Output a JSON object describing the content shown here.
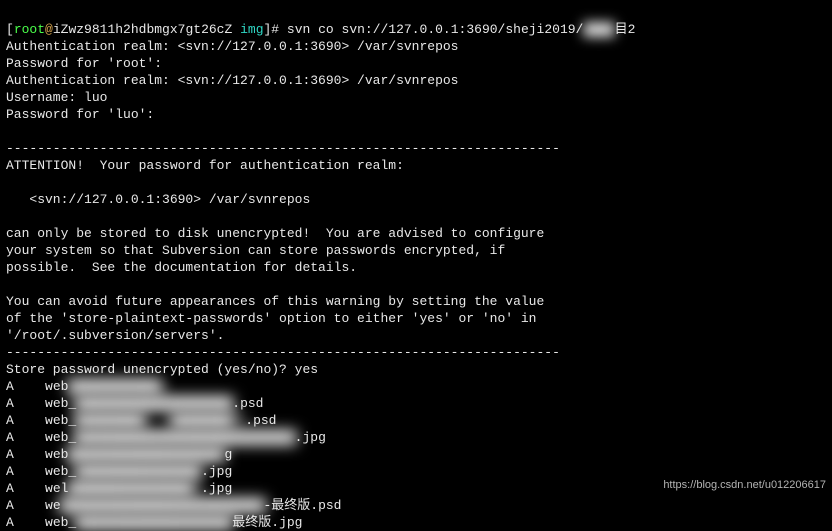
{
  "prompt": {
    "open_br": "[",
    "user": "root",
    "at": "@",
    "host": "iZwz9811h2hdbmgx7gt26cZ",
    "dir": "img",
    "close_br": "]# ",
    "command": "svn co svn://127.0.0.1:3690/sheji2019/",
    "tail_blur": "████",
    "tail_plain": "目2"
  },
  "lines": {
    "l1": "Authentication realm: <svn://127.0.0.1:3690> /var/svnrepos",
    "l2": "Password for 'root':",
    "l3": "Authentication realm: <svn://127.0.0.1:3690> /var/svnrepos",
    "l4": "Username: luo",
    "l5": "Password for 'luo':",
    "l6": "",
    "sep": "-----------------------------------------------------------------------",
    "l7": "ATTENTION!  Your password for authentication realm:",
    "l8": "",
    "l9": "   <svn://127.0.0.1:3690> /var/svnrepos",
    "l10": "",
    "l11": "can only be stored to disk unencrypted!  You are advised to configure",
    "l12": "your system so that Subversion can store passwords encrypted, if",
    "l13": "possible.  See the documentation for details.",
    "l14": "",
    "l15": "You can avoid future appearances of this warning by setting the value",
    "l16": "of the 'store-plaintext-passwords' option to either 'yes' or 'no' in",
    "l17": "'/root/.subversion/servers'.",
    "l18": "Store password unencrypted (yes/no)? yes"
  },
  "files": {
    "prefix": "A    ",
    "r1_a": "web",
    "r1_b": "████████████",
    "r2_a": "web_",
    "r2_b": "████████████████████",
    "r2_c": ".psd",
    "r3_a": "web_",
    "r3_b": "█████████   ████████本",
    "r3_c": ".psd",
    "r4_a": "web_",
    "r4_b": "████████████████████████████",
    "r4_c": ".jpg",
    "r5_a": "web",
    "r5_b": "████████████████████",
    "r5_c": "g",
    "r6_a": "web_",
    "r6_b": "████████████████",
    "r6_c": ".jpg",
    "r7_a": "wel",
    "r7_b": "████████████████3",
    "r7_c": ".jpg",
    "r8_a": "we",
    "r8_b": "██████████████████████████",
    "r8_c": "-最终版.psd",
    "r9_a": "web_",
    "r9_b": "████████████████████",
    "r9_c": "最终版.jpg"
  },
  "watermark": "https://blog.csdn.net/u012206617"
}
